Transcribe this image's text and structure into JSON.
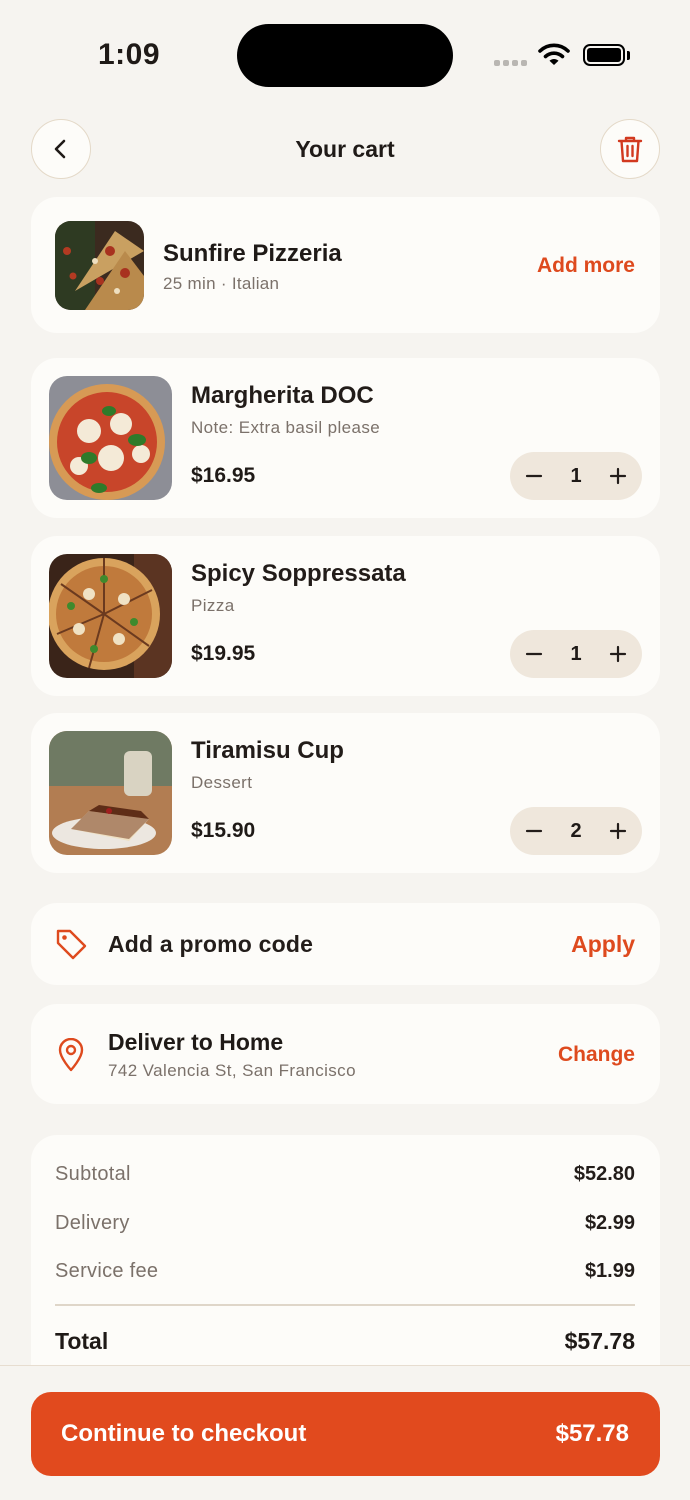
{
  "status_bar": {
    "time": "1:09"
  },
  "header": {
    "title": "Your cart"
  },
  "restaurant": {
    "name": "Sunfire Pizzeria",
    "meta": "25 min · Italian",
    "add_more_label": "Add more"
  },
  "items": [
    {
      "name": "Margherita DOC",
      "subtitle": "Note: Extra basil please",
      "price": "$16.95",
      "quantity": "1"
    },
    {
      "name": "Spicy Soppressata",
      "subtitle": "Pizza",
      "price": "$19.95",
      "quantity": "1"
    },
    {
      "name": "Tiramisu Cup",
      "subtitle": "Dessert",
      "price": "$15.90",
      "quantity": "2"
    }
  ],
  "promo": {
    "label": "Add a promo code",
    "action": "Apply"
  },
  "delivery": {
    "title": "Deliver to Home",
    "address": "742 Valencia St, San Francisco",
    "action": "Change"
  },
  "summary": {
    "subtotal_label": "Subtotal",
    "subtotal": "$52.80",
    "delivery_label": "Delivery",
    "delivery": "$2.99",
    "service_label": "Service fee",
    "service": "$1.99",
    "total_label": "Total",
    "total": "$57.78"
  },
  "checkout": {
    "label": "Continue to checkout",
    "amount": "$57.78"
  },
  "colors": {
    "accent": "#e14a1e",
    "background": "#f6f4f0",
    "card": "#fdfcf9",
    "stepper": "#efe7dc"
  },
  "icons": [
    "chevron-left-icon",
    "trash-icon",
    "minus-icon",
    "plus-icon",
    "tag-icon",
    "location-pin-icon"
  ]
}
